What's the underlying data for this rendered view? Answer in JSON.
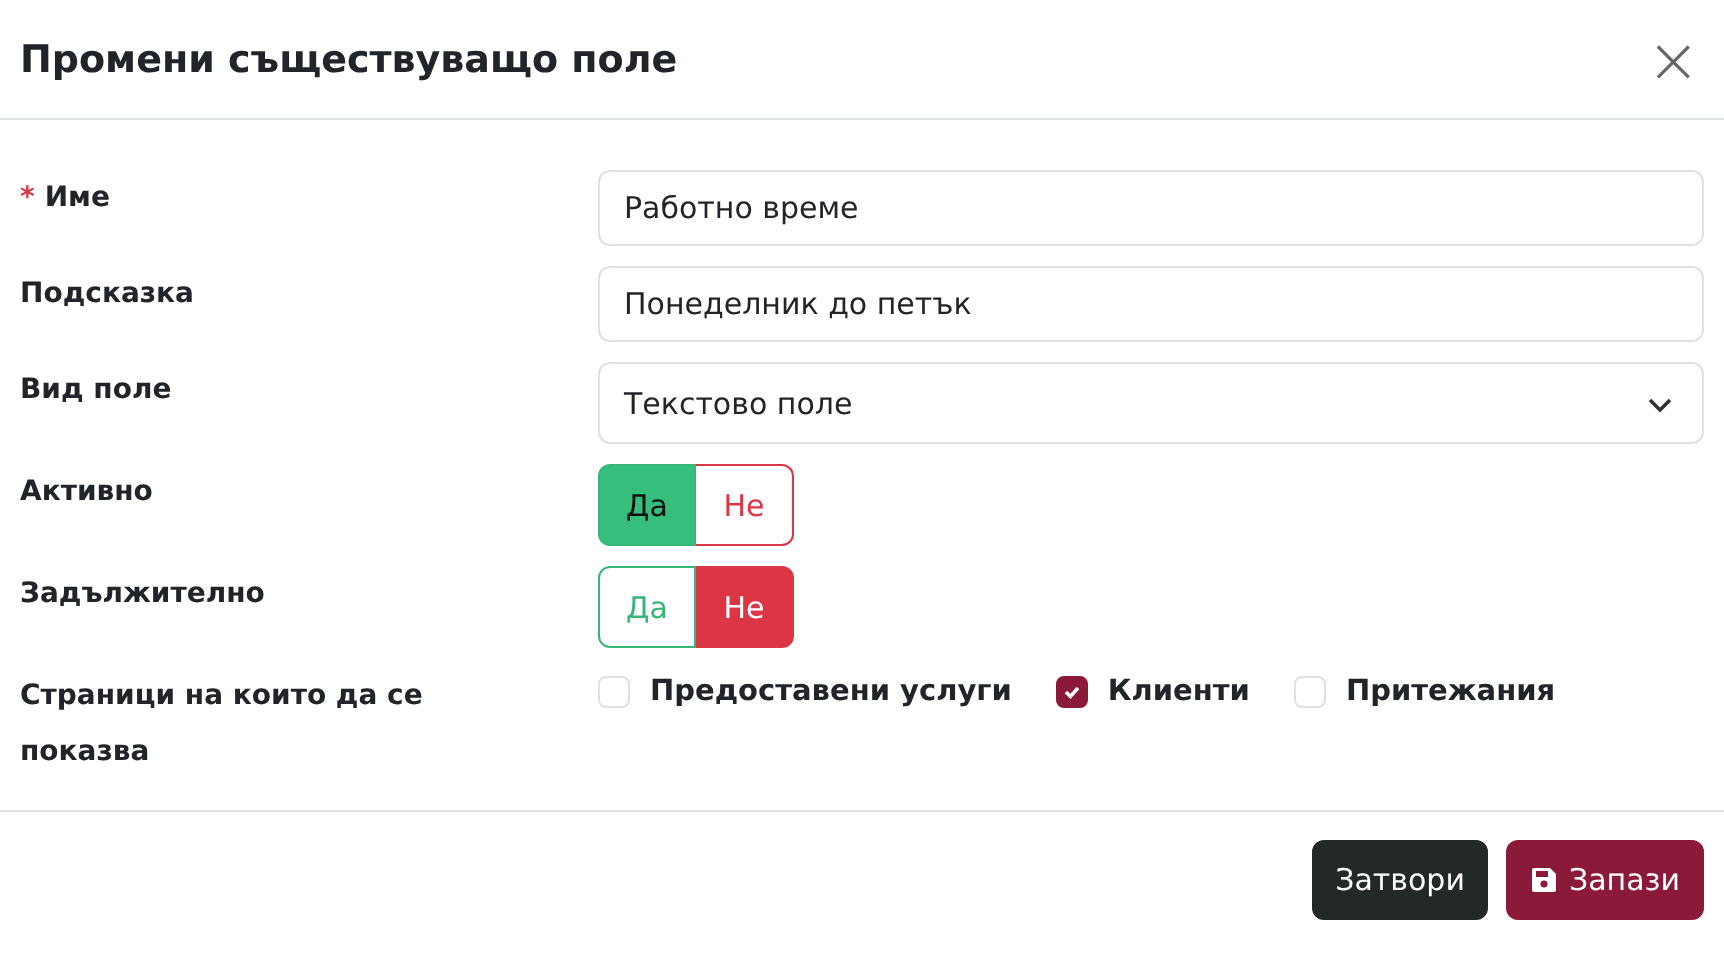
{
  "dialog": {
    "title": "Промени съществуващо поле",
    "close": "×"
  },
  "fields": [
    {
      "kind": "text",
      "label": "Име",
      "required_mark": "*",
      "value": "Работно време"
    },
    {
      "kind": "text",
      "label": "Подсказка",
      "value": "Понеделник до петък"
    },
    {
      "kind": "select",
      "label": "Вид поле",
      "value": "Текстово поле"
    },
    {
      "kind": "toggle",
      "label": "Активно",
      "options": [
        {
          "label": "Да",
          "kind": "yes",
          "selected": true
        },
        {
          "label": "Не",
          "kind": "no",
          "selected": false
        }
      ]
    },
    {
      "kind": "toggle",
      "label": "Задължително",
      "options": [
        {
          "label": "Да",
          "kind": "yes",
          "selected": false
        },
        {
          "label": "Не",
          "kind": "no",
          "selected": true
        }
      ]
    },
    {
      "kind": "checkboxes",
      "label": "Страници на които да се показва",
      "options": [
        {
          "label": "Предоставени услуги",
          "checked": false
        },
        {
          "label": "Клиенти",
          "checked": true
        },
        {
          "label": "Притежания",
          "checked": false
        }
      ]
    }
  ],
  "buttons": [
    {
      "label": "Затвори",
      "kind": "secondary"
    },
    {
      "label": "Запази",
      "kind": "primary"
    }
  ]
}
